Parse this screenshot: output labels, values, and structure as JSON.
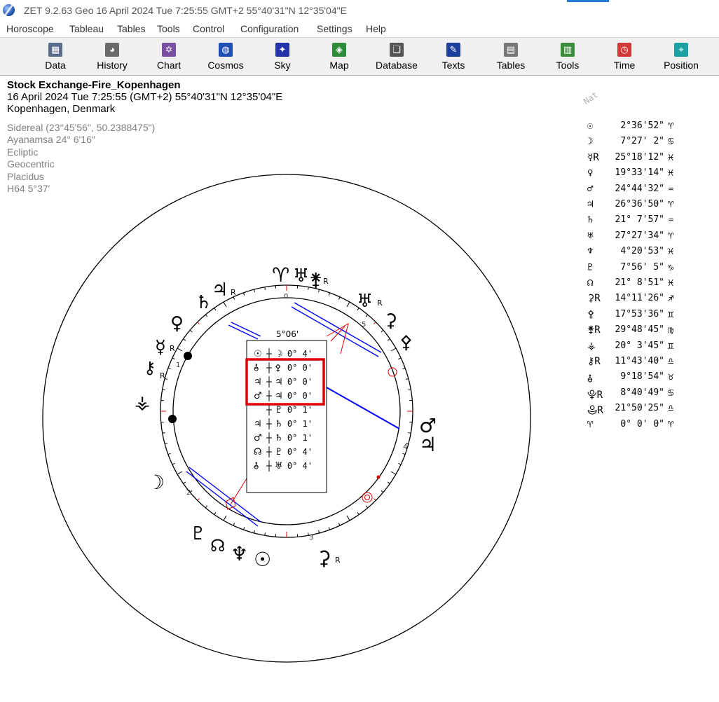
{
  "window": {
    "title": "ZET 9.2.63 Geo   16 April 2024  Tue   7:25:55 GMT+2 55°40'31\"N  12°35'04\"E"
  },
  "menu": [
    "Horoscope",
    "Tableau",
    "Tables",
    "Tools",
    "Control",
    "Configuration",
    "Settings",
    "Help"
  ],
  "toolbar": [
    {
      "label": "Data",
      "icon": "data-grid-icon",
      "color": "#5b6b8a"
    },
    {
      "label": "History",
      "icon": "history-icon",
      "color": "#6a6a6a"
    },
    {
      "label": "Chart",
      "icon": "chart-wheel-icon",
      "color": "#7a4fa0"
    },
    {
      "label": "Cosmos",
      "icon": "cosmos-icon",
      "color": "#1f4fb5"
    },
    {
      "label": "Sky",
      "icon": "sky-icon",
      "color": "#2533a8"
    },
    {
      "label": "Map",
      "icon": "map-icon",
      "color": "#2e8b3a"
    },
    {
      "label": "Database",
      "icon": "database-icon",
      "color": "#555555"
    },
    {
      "label": "Texts",
      "icon": "texts-icon",
      "color": "#1d3f9e"
    },
    {
      "label": "Tables",
      "icon": "tables-icon",
      "color": "#777777"
    },
    {
      "label": "Tools",
      "icon": "tools-icon",
      "color": "#3c8a3c"
    },
    {
      "label": "Time",
      "icon": "time-icon",
      "color": "#d23a3a"
    },
    {
      "label": "Position",
      "icon": "position-icon",
      "color": "#1aa1a1"
    }
  ],
  "chart_info": {
    "title": "Stock Exchange-Fire_Kopenhagen",
    "datetime": "16 April 2024  Tue   7:25:55 (GMT+2) 55°40'31\"N  12°35'04\"E",
    "place": "Kopenhagen, Denmark"
  },
  "settings": [
    "Sidereal (23°45'56\", 50.2388475\")",
    "Ayanamsa 24° 6'16\"",
    "Ecliptic",
    "Geocentric",
    "Placidus",
    "H64   5°37'"
  ],
  "aspect_box": {
    "header": "5°06'",
    "rows": [
      {
        "a": "☉",
        "b": "☽",
        "orb": "- 0° 4'"
      },
      {
        "a": "⯗",
        "b": "⚴",
        "orb": "0° 0'"
      },
      {
        "a": "♃",
        "b": "♃",
        "orb": "0° 0'"
      },
      {
        "a": "♂",
        "b": "♃",
        "orb": "0° 0'"
      },
      {
        "a": "",
        "b": "♇",
        "orb": "0° 1'"
      },
      {
        "a": "♃",
        "b": "♄",
        "orb": "0° 1'"
      },
      {
        "a": "♂",
        "b": "♄",
        "orb": "0° 1'"
      },
      {
        "a": "☊",
        "b": "♇",
        "orb": "0° 4'"
      },
      {
        "a": "⯗",
        "b": "♅",
        "orb": "0° 4'"
      }
    ],
    "highlight_color": "#e00000"
  },
  "houses": [
    "0",
    "1",
    "2",
    "3",
    "4",
    "5"
  ],
  "planet_table": {
    "label": "Nat",
    "rows": [
      {
        "sym": "☉",
        "val": "2°36'52\"",
        "sign": "♈"
      },
      {
        "sym": "☽",
        "val": "7°27' 2\"",
        "sign": "♋"
      },
      {
        "sym": "☿R",
        "val": "25°18'12\"",
        "sign": "♓"
      },
      {
        "sym": "♀",
        "val": "19°33'14\"",
        "sign": "♓"
      },
      {
        "sym": "♂",
        "val": "24°44'32\"",
        "sign": "♒"
      },
      {
        "sym": "♃",
        "val": "26°36'50\"",
        "sign": "♈"
      },
      {
        "sym": "♄",
        "val": "21° 7'57\"",
        "sign": "♒"
      },
      {
        "sym": "♅",
        "val": "27°27'34\"",
        "sign": "♈"
      },
      {
        "sym": "♆",
        "val": "4°20'53\"",
        "sign": "♓"
      },
      {
        "sym": "♇",
        "val": "7°56' 5\"",
        "sign": "♑"
      },
      {
        "sym": "☊",
        "val": "21° 8'51\"",
        "sign": "♓"
      },
      {
        "sym": "⚳R",
        "val": "14°11'26\"",
        "sign": "♐"
      },
      {
        "sym": "⚴",
        "val": "17°53'36\"",
        "sign": "♊"
      },
      {
        "sym": "⚵R",
        "val": "29°48'45\"",
        "sign": "♍"
      },
      {
        "sym": "⚶",
        "val": "20° 3'45\"",
        "sign": "♊"
      },
      {
        "sym": "⚷R",
        "val": "11°43'40\"",
        "sign": "♎"
      },
      {
        "sym": "⯗",
        "val": "9°18'54\"",
        "sign": "♉"
      },
      {
        "sym": "⯓R",
        "val": "8°40'49\"",
        "sign": "♋"
      },
      {
        "sym": "⯕R",
        "val": "21°50'25\"",
        "sign": "♎"
      },
      {
        "sym": "♈",
        "val": "0° 0' 0\"",
        "sign": "♈"
      }
    ]
  },
  "wheel_glyphs": [
    {
      "text": "♈",
      "name": "aries-glyph"
    },
    {
      "text": "♅",
      "name": "uranus-glyph"
    },
    {
      "text": "⚵",
      "name": "juno-glyph"
    },
    {
      "text": "R",
      "name": "retro-mark"
    },
    {
      "text": "♄",
      "name": "saturn-glyph"
    },
    {
      "text": "♃",
      "name": "jupiter-glyph"
    },
    {
      "text": "R",
      "name": "retro-mark"
    },
    {
      "text": "♀",
      "name": "venus-glyph"
    },
    {
      "text": "☿",
      "name": "mercury-glyph"
    },
    {
      "text": "R",
      "name": "retro-mark"
    },
    {
      "text": "⚷",
      "name": "chiron-glyph"
    },
    {
      "text": "R",
      "name": "retro-mark"
    },
    {
      "text": "⚶",
      "name": "vesta-glyph"
    },
    {
      "text": "☽",
      "name": "moon-glyph"
    },
    {
      "text": "♇",
      "name": "pluto-glyph"
    },
    {
      "text": "☊",
      "name": "node-glyph"
    },
    {
      "text": "♆",
      "name": "neptune-glyph"
    },
    {
      "text": "☉",
      "name": "sun-glyph"
    },
    {
      "text": "⚳",
      "name": "ceres-glyph"
    },
    {
      "text": "R",
      "name": "retro-mark"
    },
    {
      "text": "♂",
      "name": "mars-glyph"
    },
    {
      "text": "♃",
      "name": "jupiter-glyph-2"
    },
    {
      "text": "⚴",
      "name": "pallas-glyph"
    },
    {
      "text": "♅",
      "name": "uranus-glyph-2"
    },
    {
      "text": "⚳",
      "name": "ceres-glyph-2"
    },
    {
      "text": "R",
      "name": "retro-mark"
    }
  ]
}
